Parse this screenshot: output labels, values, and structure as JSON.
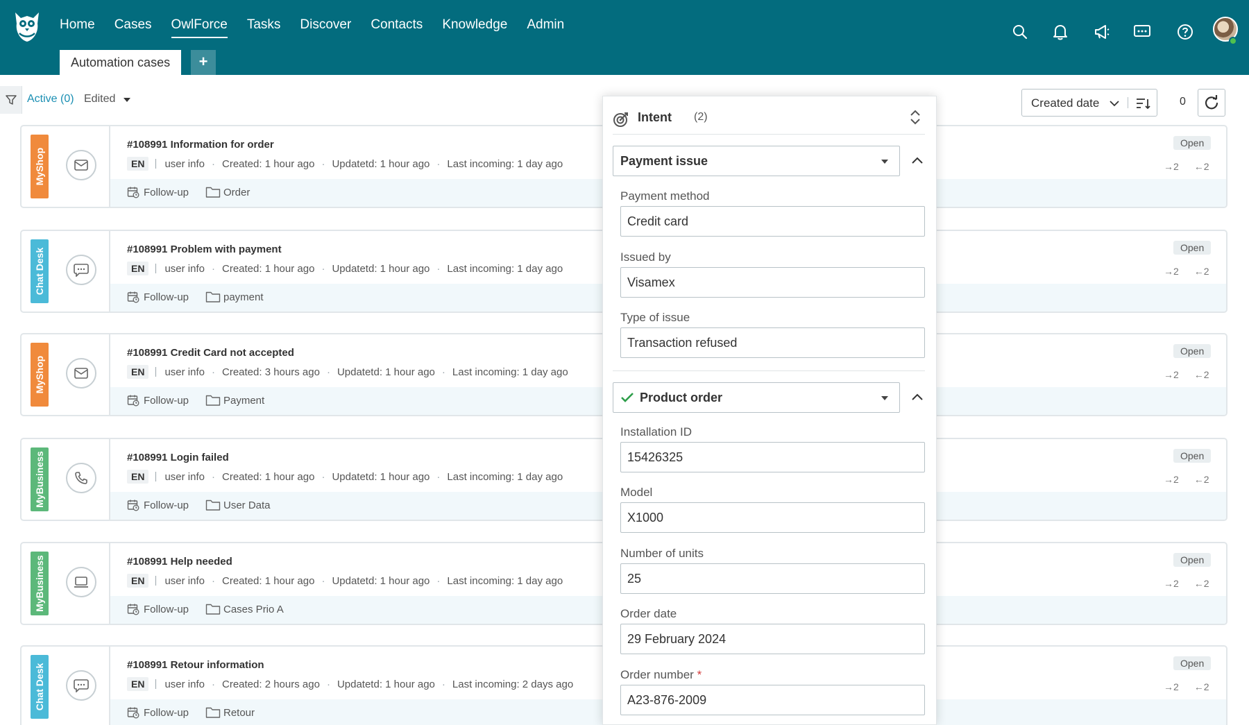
{
  "header": {
    "nav": [
      {
        "label": "Home",
        "active": false
      },
      {
        "label": "Cases",
        "active": false
      },
      {
        "label": "OwlForce",
        "active": true
      },
      {
        "label": "Tasks",
        "active": false
      },
      {
        "label": "Discover",
        "active": false
      },
      {
        "label": "Contacts",
        "active": false
      },
      {
        "label": "Knowledge",
        "active": false
      },
      {
        "label": "Admin",
        "active": false
      }
    ],
    "tab_label": "Automation cases",
    "tab_add": "+",
    "icons": [
      "search-icon",
      "bell-icon",
      "megaphone-icon",
      "chat-icon",
      "help-icon"
    ],
    "colors": {
      "bar": "#036c7e",
      "accent": "#1a8fb3"
    }
  },
  "filter": {
    "active_label": "Active",
    "active_count": "(0)",
    "edited_label": "Edited",
    "sort_label": "Created date",
    "result_count": "0"
  },
  "cases": [
    {
      "brand": "MyShop",
      "brand_color": "#f08a3c",
      "channel_icon": "mail-icon",
      "title": "#108991 Information for order",
      "lang": "EN",
      "user": "user info",
      "created": "Created: 1 hour ago",
      "updated": "Updatetd: 1 hour ago",
      "last": "Last incoming: 1 day ago",
      "follow": "Follow-up",
      "folder": "Order",
      "status": "Open",
      "out_count": "2",
      "in_count": "2"
    },
    {
      "brand": "Chat Desk",
      "brand_color": "#4bbad8",
      "channel_icon": "chat-icon",
      "title": "#108991 Problem with payment",
      "lang": "EN",
      "user": "user info",
      "created": "Created: 1 hour ago",
      "updated": "Updatetd: 1 hour ago",
      "last": "Last incoming: 1 day ago",
      "follow": "Follow-up",
      "folder": "payment",
      "status": "Open",
      "out_count": "2",
      "in_count": "2"
    },
    {
      "brand": "MyShop",
      "brand_color": "#f08a3c",
      "channel_icon": "mail-icon",
      "title": "#108991 Credit Card not accepted",
      "lang": "EN",
      "user": "user info",
      "created": "Created: 3 hours ago",
      "updated": "Updatetd: 1 hour ago",
      "last": "Last incoming: 1 day ago",
      "follow": "Follow-up",
      "folder": "Payment",
      "status": "Open",
      "out_count": "2",
      "in_count": "2"
    },
    {
      "brand": "MyBusiness",
      "brand_color": "#5cb87a",
      "channel_icon": "phone-icon",
      "title": "#108991 Login failed",
      "lang": "EN",
      "user": "user info",
      "created": "Created: 1 hour ago",
      "updated": "Updatetd: 1 hour ago",
      "last": "Last incoming: 1 day ago",
      "follow": "Follow-up",
      "folder": "User Data",
      "status": "Open",
      "out_count": "2",
      "in_count": "2"
    },
    {
      "brand": "MyBusiness",
      "brand_color": "#5cb87a",
      "channel_icon": "laptop-icon",
      "title": "#108991 Help needed",
      "lang": "EN",
      "user": "user info",
      "created": "Created: 1 hour ago",
      "updated": "Updatetd: 1 hour ago",
      "last": "Last incoming: 1 day ago",
      "follow": "Follow-up",
      "folder": "Cases Prio A",
      "status": "Open",
      "out_count": "2",
      "in_count": "2"
    },
    {
      "brand": "Chat Desk",
      "brand_color": "#4bbad8",
      "channel_icon": "chat-icon",
      "title": "#108991 Retour information",
      "lang": "EN",
      "user": "user info",
      "created": "Created: 2 hours ago",
      "updated": "Updatetd: 1 hour ago",
      "last": "Last incoming: 2 days ago",
      "follow": "Follow-up",
      "folder": "Retour",
      "status": "Open",
      "out_count": "2",
      "in_count": "2"
    }
  ],
  "intent_panel": {
    "title": "Intent",
    "count": "(2)",
    "intents": [
      {
        "name": "Payment issue",
        "checked": false,
        "fields": [
          {
            "label": "Payment method",
            "value": "Credit card",
            "required": false
          },
          {
            "label": "Issued by",
            "value": "Visamex",
            "required": false
          },
          {
            "label": "Type of issue",
            "value": "Transaction refused",
            "required": false
          }
        ]
      },
      {
        "name": "Product order",
        "checked": true,
        "fields": [
          {
            "label": "Installation ID",
            "value": "15426325",
            "required": false
          },
          {
            "label": "Model",
            "value": "X1000",
            "required": false
          },
          {
            "label": "Number of units",
            "value": "25",
            "required": false
          },
          {
            "label": "Order date",
            "value": "29 February 2024",
            "required": false
          },
          {
            "label": "Order number",
            "value": "A23-876-2009",
            "required": true,
            "required_mark": "*"
          }
        ]
      }
    ]
  }
}
